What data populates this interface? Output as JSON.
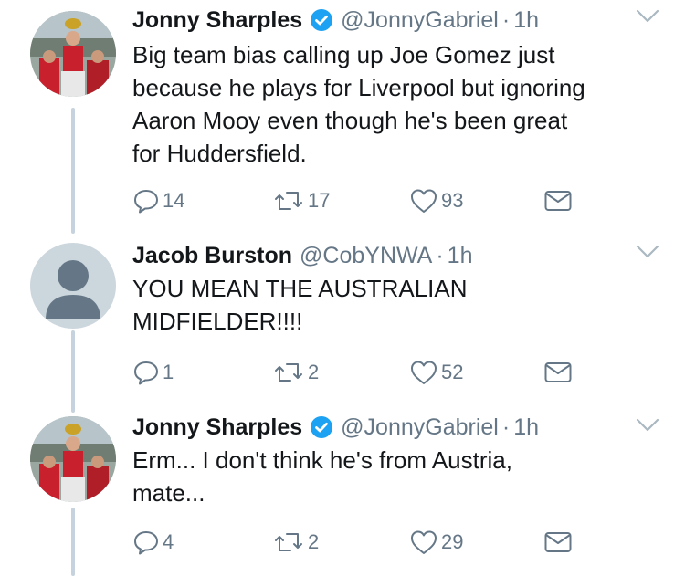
{
  "tweets": [
    {
      "name": "Jonny Sharples",
      "verified": true,
      "handle": "@JonnyGabriel",
      "separator": "·",
      "time": "1h",
      "lines": [
        "Big team bias calling up Joe Gomez just",
        "because he plays for Liverpool but ignoring",
        "Aaron Mooy even though he's been great",
        "for Huddersfield."
      ],
      "replies": "14",
      "retweets": "17",
      "likes": "93",
      "avatar": "photo-avatar"
    },
    {
      "name": "Jacob Burston",
      "verified": false,
      "handle": "@CobYNWA",
      "separator": "·",
      "time": "1h",
      "lines": [
        "YOU MEAN THE AUSTRALIAN",
        "MIDFIELDER!!!!"
      ],
      "replies": "1",
      "retweets": "2",
      "likes": "52",
      "avatar": "default-avatar"
    },
    {
      "name": "Jonny Sharples",
      "verified": true,
      "handle": "@JonnyGabriel",
      "separator": "·",
      "time": "1h",
      "lines": [
        "Erm... I don't think he's from Austria,",
        "mate..."
      ],
      "replies": "4",
      "retweets": "2",
      "likes": "29",
      "avatar": "photo-avatar"
    }
  ],
  "icons": {
    "reply": "reply-icon",
    "retweet": "retweet-icon",
    "like": "heart-icon",
    "dm": "envelope-icon",
    "more": "chevron-down-icon",
    "verified": "verified-badge-icon"
  },
  "colors": {
    "text": "#14171a",
    "secondary": "#657786",
    "verified": "#1da1f2",
    "thread_line": "#c6d3de"
  }
}
